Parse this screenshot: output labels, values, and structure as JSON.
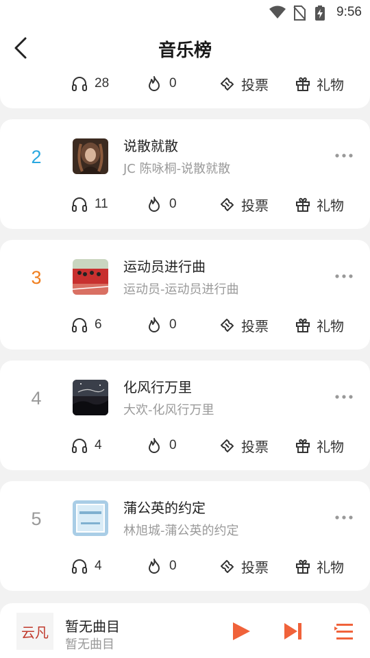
{
  "status": {
    "time": "9:56"
  },
  "header": {
    "title": "音乐榜"
  },
  "labels": {
    "vote": "投票",
    "gift": "礼物"
  },
  "partial_card": {
    "listens": "28",
    "hot": "0"
  },
  "entries": [
    {
      "rank": "2",
      "rank_color": "#2aa8e0",
      "song": "说散就散",
      "artist": "JC 陈咏桐-说散就散",
      "listens": "11",
      "hot": "0",
      "cover": "cover-portrait"
    },
    {
      "rank": "3",
      "rank_color": "#f07f1f",
      "song": "运动员进行曲",
      "artist": "运动员-运动员进行曲",
      "listens": "6",
      "hot": "0",
      "cover": "cover-track-race"
    },
    {
      "rank": "4",
      "rank_color": "#999999",
      "song": "化风行万里",
      "artist": "大欢-化风行万里",
      "listens": "4",
      "hot": "0",
      "cover": "cover-night-sky"
    },
    {
      "rank": "5",
      "rank_color": "#999999",
      "song": "蒲公英的约定",
      "artist": "林旭城-蒲公英的约定",
      "listens": "4",
      "hot": "0",
      "cover": "cover-blue-frame"
    }
  ],
  "player": {
    "logo_text": "云凡",
    "title": "暂无曲目",
    "subtitle": "暂无曲目"
  },
  "colors": {
    "accent": "#f0623a",
    "background": "#f2f2f2"
  }
}
